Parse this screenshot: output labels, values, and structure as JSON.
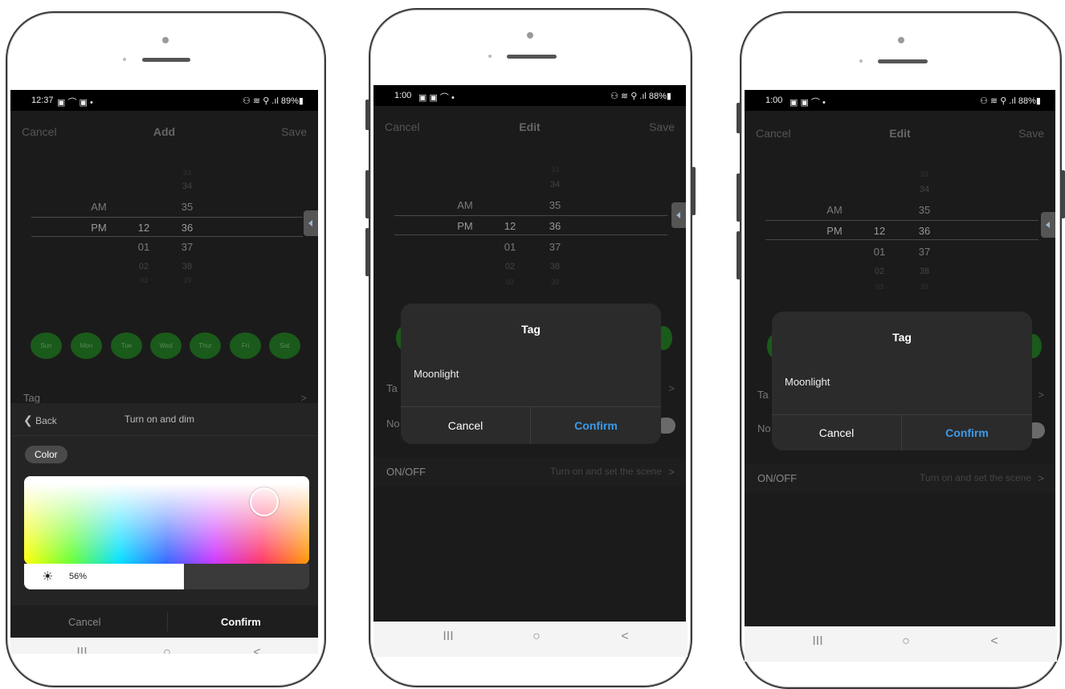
{
  "phone1": {
    "status": {
      "time": "12:37",
      "left_icons": "▣ ⌒ ▣ •",
      "right": "⚇ ≋ ⚲ .ıl 89%▮"
    },
    "nav": {
      "cancel": "Cancel",
      "title": "Add",
      "save": "Save"
    },
    "picker": {
      "period": [
        "AM",
        "PM"
      ],
      "hours": [
        "12",
        "01",
        "02",
        "03"
      ],
      "minutes": [
        "33",
        "34",
        "35",
        "36",
        "37",
        "38",
        "39"
      ]
    },
    "days": [
      "Sun",
      "Mon",
      "Tue",
      "Wed",
      "Thur",
      "Fri",
      "Sat"
    ],
    "tag_row": {
      "label": "Tag",
      "chevron": ">"
    },
    "sheet": {
      "back": "Back",
      "title": "Turn on and dim",
      "color_chip": "Color",
      "brightness_label": "56%",
      "brightness_value": 0.56,
      "cancel": "Cancel",
      "confirm": "Confirm"
    },
    "bottom_nav": {
      "recent": "III",
      "home": "○",
      "back": "<"
    }
  },
  "phone2": {
    "status": {
      "time": "1:00",
      "left_icons": "▣ ▣ ⌒ •",
      "right": "⚇ ≋ ⚲ .ıl 88%▮"
    },
    "nav": {
      "cancel": "Cancel",
      "title": "Edit",
      "save": "Save"
    },
    "picker": {
      "period": [
        "AM",
        "PM"
      ],
      "hours": [
        "12",
        "01",
        "02",
        "03"
      ],
      "minutes": [
        "33",
        "34",
        "35",
        "36",
        "37",
        "38",
        "39"
      ]
    },
    "rows": {
      "tag": "Ta",
      "notif": "No",
      "onoff_label": "ON/OFF",
      "onoff_value": "Turn on and set the scene",
      "chevron": ">"
    },
    "dialog": {
      "title": "Tag",
      "text": "Moonlight",
      "cancel": "Cancel",
      "confirm": "Confirm"
    },
    "bottom_nav": {
      "recent": "III",
      "home": "○",
      "back": "<"
    }
  },
  "phone3": {
    "status": {
      "time": "1:00",
      "left_icons": "▣ ▣ ⌒ •",
      "right": "⚇ ≋ ⚲ .ıl 88%▮"
    },
    "nav": {
      "cancel": "Cancel",
      "title": "Edit",
      "save": "Save"
    },
    "picker": {
      "period": [
        "AM",
        "PM"
      ],
      "hours": [
        "12",
        "01",
        "02",
        "03"
      ],
      "minutes": [
        "33",
        "34",
        "35",
        "36",
        "37",
        "38",
        "39"
      ]
    },
    "rows": {
      "tag": "Ta",
      "notif": "No",
      "onoff_label": "ON/OFF",
      "onoff_value": "Turn on and set the scene",
      "chevron": ">"
    },
    "dialog": {
      "title": "Tag",
      "text": "Moonlight",
      "cancel": "Cancel",
      "confirm": "Confirm"
    },
    "bottom_nav": {
      "recent": "III",
      "home": "○",
      "back": "<"
    }
  },
  "colors": {
    "accent_blue": "#3d9be9",
    "day_green": "#1a5a1a",
    "screen_bg": "#1b1b1b"
  }
}
